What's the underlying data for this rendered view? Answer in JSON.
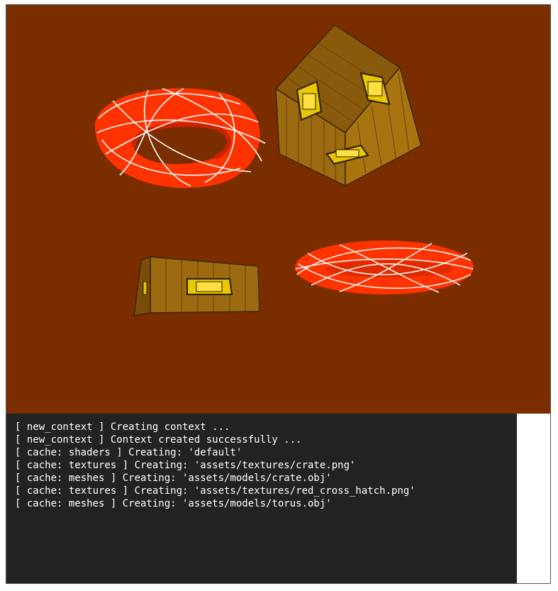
{
  "scene": {
    "background_color": "#7a2e00",
    "objects": [
      {
        "name": "torus-large",
        "mesh": "torus",
        "texture": "red_cross_hatch",
        "color": "#ff3300"
      },
      {
        "name": "crate-large",
        "mesh": "crate",
        "texture": "crate",
        "color": "#9c6a10"
      },
      {
        "name": "crate-small",
        "mesh": "crate",
        "texture": "crate",
        "color": "#9c6a10"
      },
      {
        "name": "torus-flat",
        "mesh": "torus",
        "texture": "red_cross_hatch",
        "color": "#ff3300"
      }
    ]
  },
  "console": {
    "background_color": "#222222",
    "text_color": "#ffffff",
    "lines": [
      "[ new_context ] Creating context ...",
      "[ new_context ] Context created successfully ...",
      "[ cache: shaders ] Creating: 'default'",
      "[ cache: textures ] Creating: 'assets/textures/crate.png'",
      "[ cache: meshes ] Creating: 'assets/models/crate.obj'",
      "[ cache: textures ] Creating: 'assets/textures/red_cross_hatch.png'",
      "[ cache: meshes ] Creating: 'assets/models/torus.obj'"
    ]
  }
}
